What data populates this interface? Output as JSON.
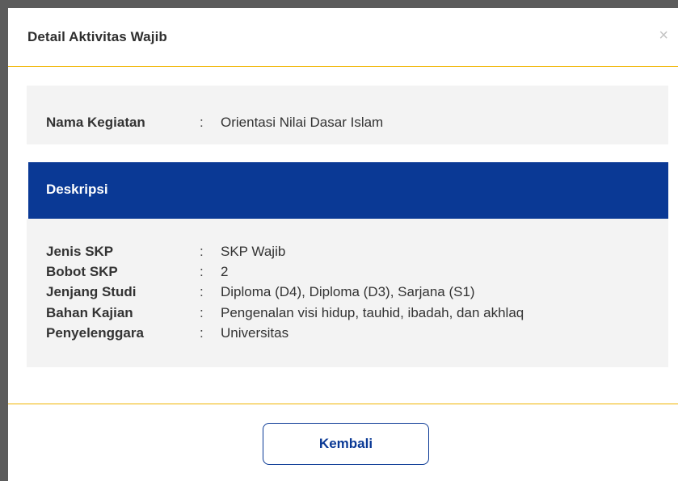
{
  "modal": {
    "title": "Detail Aktivitas Wajib",
    "close_symbol": "×"
  },
  "activity": {
    "label": "Nama Kegiatan",
    "colon": ":",
    "value": "Orientasi Nilai Dasar Islam"
  },
  "description": {
    "heading": "Deskripsi",
    "rows": [
      {
        "label": "Jenis SKP",
        "colon": ":",
        "value": "SKP Wajib"
      },
      {
        "label": "Bobot SKP",
        "colon": ":",
        "value": "2"
      },
      {
        "label": "Jenjang Studi",
        "colon": ":",
        "value": "Diploma (D4), Diploma (D3), Sarjana (S1)"
      },
      {
        "label": "Bahan Kajian",
        "colon": ":",
        "value": "Pengenalan visi hidup, tauhid, ibadah, dan akhlaq"
      },
      {
        "label": "Penyelenggara",
        "colon": ":",
        "value": "Universitas"
      }
    ]
  },
  "footer": {
    "back_label": "Kembali"
  },
  "colors": {
    "primary": "#0a3995",
    "accent_line": "#f0b400",
    "panel_bg": "#f3f3f3"
  }
}
